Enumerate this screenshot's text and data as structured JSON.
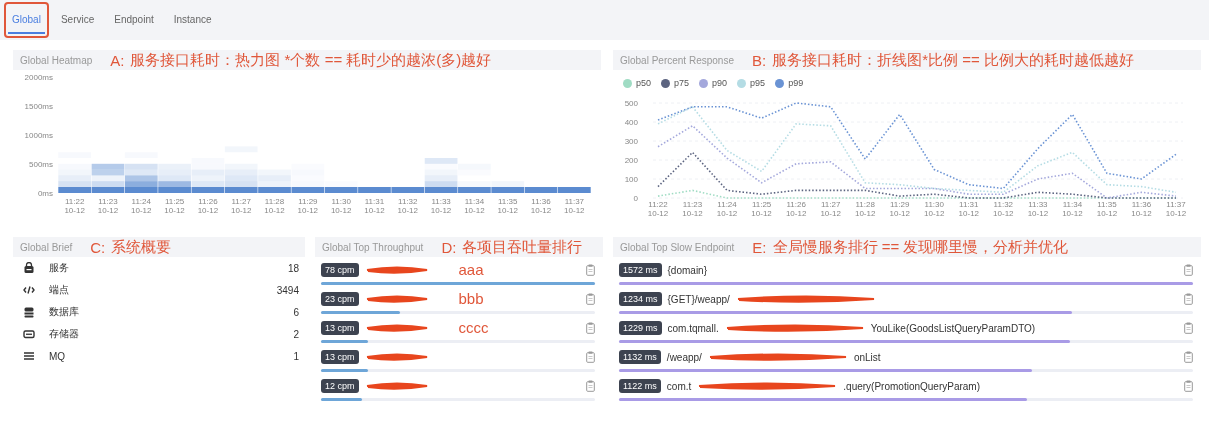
{
  "tabs": [
    {
      "label": "Global",
      "selected": true,
      "annotated": true
    },
    {
      "label": "Service",
      "selected": false,
      "annotated": false
    },
    {
      "label": "Endpoint",
      "selected": false,
      "annotated": false
    },
    {
      "label": "Instance",
      "selected": false,
      "annotated": false
    }
  ],
  "heatmap": {
    "title": "Global Heatmap",
    "annotation": {
      "letter": "A:",
      "text": "服务接口耗时：热力图 *个数 == 耗时少的越浓(多)越好"
    },
    "yticks": [
      "2000ms",
      "1500ms",
      "1000ms",
      "500ms",
      "0ms"
    ],
    "xlabels": [
      "11:22 10-12",
      "11:23 10-12",
      "11:24 10-12",
      "11:25 10-12",
      "11:26 10-12",
      "11:27 10-12",
      "11:28 10-12",
      "11:29 10-12",
      "11:30 10-12",
      "11:31 10-12",
      "11:32 10-12",
      "11:33 10-12",
      "11:34 10-12",
      "11:35 10-12",
      "11:36 10-12",
      "11:37 10-12"
    ]
  },
  "percent": {
    "title": "Global Percent Response",
    "annotation": {
      "letter": "B:",
      "text": "服务接口耗时：折线图*比例 == 比例大的耗时越低越好"
    },
    "chart_data": {
      "type": "line",
      "categories": [
        "11:22 10-12",
        "11:23 10-12",
        "11:24 10-12",
        "11:25 10-12",
        "11:26 10-12",
        "11:27 10-12",
        "11:28 10-12",
        "11:29 10-12",
        "11:30 10-12",
        "11:31 10-12",
        "11:32 10-12",
        "11:33 10-12",
        "11:34 10-12",
        "11:35 10-12",
        "11:36 10-12",
        "11:37 10-12"
      ],
      "ylim": [
        0,
        500
      ],
      "grid": true,
      "yticks": [
        0,
        100,
        200,
        300,
        400,
        500
      ],
      "series": [
        {
          "name": "p50",
          "color": "#a0dcc4",
          "line_style": "dotted",
          "values": [
            10,
            40,
            0,
            0,
            0,
            0,
            0,
            0,
            0,
            0,
            0,
            0,
            0,
            0,
            0,
            0
          ]
        },
        {
          "name": "p75",
          "color": "#5c6480",
          "line_style": "dotted",
          "values": [
            60,
            240,
            40,
            20,
            40,
            40,
            40,
            10,
            20,
            0,
            0,
            30,
            20,
            0,
            0,
            0
          ]
        },
        {
          "name": "p90",
          "color": "#a4a8dc",
          "line_style": "dotted",
          "values": [
            270,
            380,
            210,
            80,
            180,
            190,
            50,
            50,
            50,
            20,
            20,
            100,
            130,
            0,
            30,
            10
          ]
        },
        {
          "name": "p95",
          "color": "#b4dce4",
          "line_style": "dotted",
          "values": [
            390,
            480,
            250,
            140,
            390,
            380,
            80,
            70,
            50,
            40,
            30,
            170,
            240,
            70,
            60,
            30
          ]
        },
        {
          "name": "p99",
          "color": "#6a93d4",
          "line_style": "dotted",
          "values": [
            410,
            480,
            480,
            420,
            500,
            480,
            205,
            440,
            150,
            70,
            50,
            260,
            440,
            130,
            100,
            230
          ]
        }
      ]
    }
  },
  "brief": {
    "title": "Global Brief",
    "annotation": {
      "letter": "C:",
      "text": "系统概要"
    },
    "items": [
      {
        "kind": "service",
        "label": "服务",
        "count": "18"
      },
      {
        "kind": "endpoint",
        "label": "端点",
        "count": "3494"
      },
      {
        "kind": "database",
        "label": "数据库",
        "count": "6"
      },
      {
        "kind": "storage",
        "label": "存储器",
        "count": "2"
      },
      {
        "kind": "mq",
        "label": "MQ",
        "count": "1"
      }
    ]
  },
  "throughput": {
    "title": "Global Top Throughput",
    "annotation": {
      "letter": "D:",
      "text": "各项目吞吐量排行"
    },
    "rows": [
      {
        "value": "78 cpm",
        "level": 1.0,
        "segments": [
          {
            "kind": "redacted"
          }
        ],
        "note": "aaa"
      },
      {
        "value": "23 cpm",
        "level": 0.29,
        "segments": [
          {
            "kind": "redacted"
          }
        ],
        "note": "bbb"
      },
      {
        "value": "13 cpm",
        "level": 0.17,
        "segments": [
          {
            "kind": "redacted"
          }
        ],
        "note": "cccc"
      },
      {
        "value": "13 cpm",
        "level": 0.17,
        "segments": [
          {
            "kind": "redacted"
          }
        ]
      },
      {
        "value": "12 cpm",
        "level": 0.15,
        "segments": [
          {
            "kind": "redacted"
          }
        ]
      }
    ]
  },
  "slow": {
    "title": "Global Top Slow Endpoint",
    "annotation": {
      "letter": "E:",
      "text": "全局慢服务排行 == 发现哪里慢，分析并优化"
    },
    "rows": [
      {
        "value": "1572 ms",
        "level": 1.0,
        "segments": [
          {
            "kind": "text",
            "text": "{domain}"
          }
        ]
      },
      {
        "value": "1234 ms",
        "level": 0.79,
        "segments": [
          {
            "kind": "text",
            "text": "{GET}/weapp/"
          },
          {
            "kind": "redacted"
          }
        ]
      },
      {
        "value": "1229 ms",
        "level": 0.785,
        "segments": [
          {
            "kind": "text",
            "text": "com.tqmall."
          },
          {
            "kind": "redacted"
          },
          {
            "kind": "text",
            "text": "YouLike(GoodsListQueryParamDTO)"
          }
        ]
      },
      {
        "value": "1132 ms",
        "level": 0.72,
        "segments": [
          {
            "kind": "text",
            "text": "/weapp/"
          },
          {
            "kind": "redacted"
          },
          {
            "kind": "text",
            "text": "onList"
          }
        ]
      },
      {
        "value": "1122 ms",
        "level": 0.71,
        "segments": [
          {
            "kind": "text",
            "text": "com.t"
          },
          {
            "kind": "redacted"
          },
          {
            "kind": "text",
            "text": ".query(PromotionQueryParam)"
          }
        ]
      }
    ]
  }
}
